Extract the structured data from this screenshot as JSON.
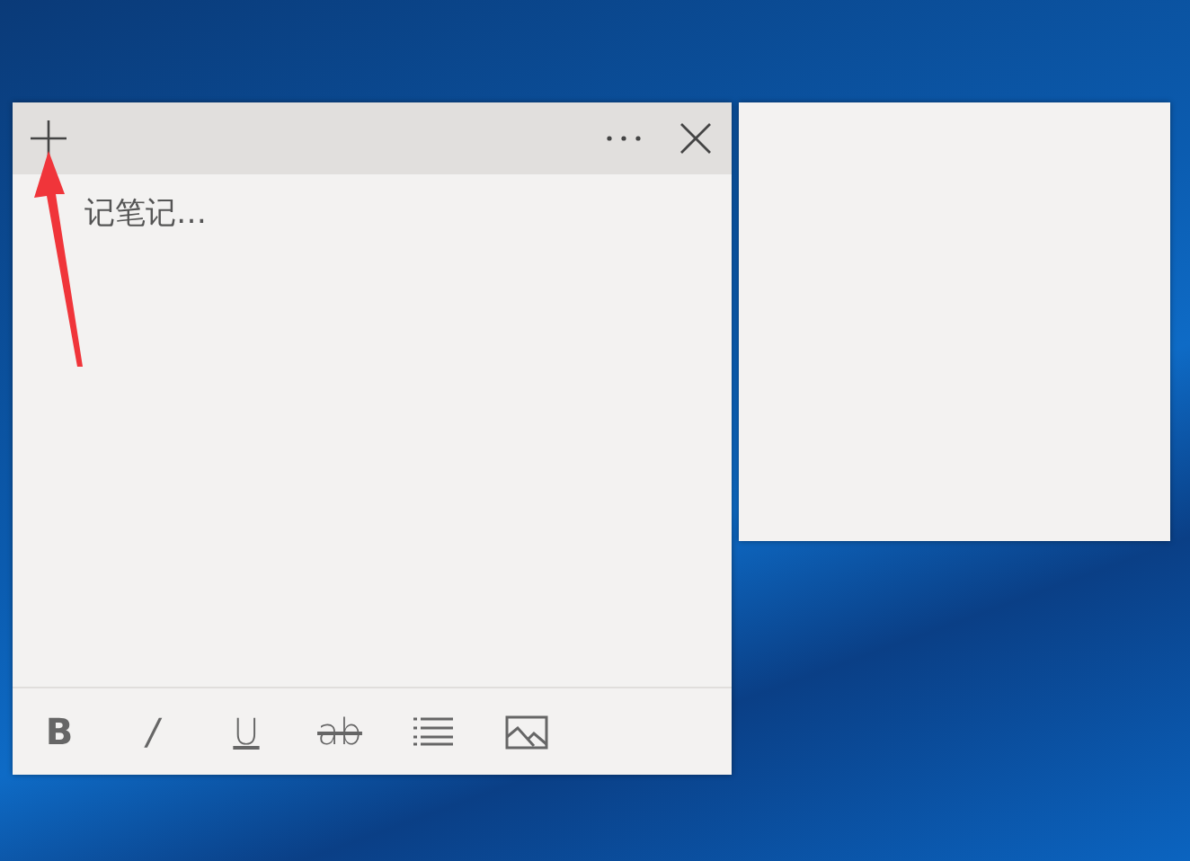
{
  "note": {
    "placeholder": "记笔记…",
    "toolbar": [
      {
        "kind": "bold",
        "label": "B"
      },
      {
        "kind": "italic",
        "label": "/"
      },
      {
        "kind": "underline",
        "label": "U"
      },
      {
        "kind": "strike",
        "label": "ab"
      },
      {
        "kind": "list"
      },
      {
        "kind": "image"
      }
    ]
  }
}
